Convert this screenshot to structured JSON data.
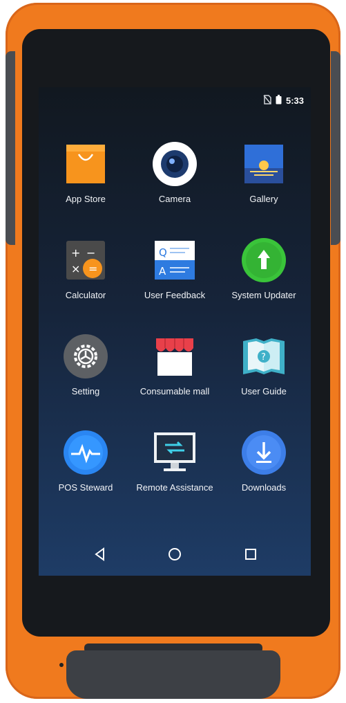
{
  "status_bar": {
    "time": "5:33",
    "icons": [
      "no-sim-icon",
      "battery-icon"
    ]
  },
  "apps": [
    {
      "label": "App Store",
      "icon": "shopping-bag-icon",
      "color": "#f7941d"
    },
    {
      "label": "Camera",
      "icon": "camera-icon",
      "color": "#ffffff"
    },
    {
      "label": "Gallery",
      "icon": "gallery-icon",
      "color": "#2f6fd8"
    },
    {
      "label": "Calculator",
      "icon": "calculator-icon",
      "color": "#4a4a4a"
    },
    {
      "label": "User Feedback",
      "icon": "feedback-icon",
      "color": "#2e7be0"
    },
    {
      "label": "System Updater",
      "icon": "update-arrow-icon",
      "color": "#3ac43a"
    },
    {
      "label": "Setting",
      "icon": "gear-icon",
      "color": "#5d6064"
    },
    {
      "label": "Consumable mall",
      "icon": "store-awning-icon",
      "color": "#e8404a"
    },
    {
      "label": "User Guide",
      "icon": "guide-book-icon",
      "color": "#3fb0c8"
    },
    {
      "label": "POS Steward",
      "icon": "heartbeat-icon",
      "color": "#2a86f2"
    },
    {
      "label": "Remote Assistance",
      "icon": "monitor-arrows-icon",
      "color": "#1f2f44"
    },
    {
      "label": "Downloads",
      "icon": "download-icon",
      "color": "#3d7ee8"
    }
  ],
  "nav_bar": {
    "back": "back-triangle-icon",
    "home": "home-circle-icon",
    "recents": "recents-square-icon"
  },
  "colors": {
    "device_orange": "#f07a1e",
    "screen_top": "#111820",
    "screen_bottom": "#1e3c66"
  }
}
